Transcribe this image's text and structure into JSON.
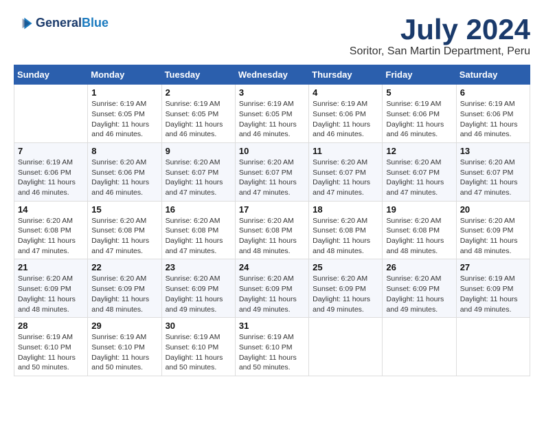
{
  "logo": {
    "line1": "General",
    "line2": "Blue"
  },
  "title": "July 2024",
  "subtitle": "Soritor, San Martin Department, Peru",
  "days_of_week": [
    "Sunday",
    "Monday",
    "Tuesday",
    "Wednesday",
    "Thursday",
    "Friday",
    "Saturday"
  ],
  "weeks": [
    [
      {
        "day": "",
        "info": ""
      },
      {
        "day": "1",
        "info": "Sunrise: 6:19 AM\nSunset: 6:05 PM\nDaylight: 11 hours\nand 46 minutes."
      },
      {
        "day": "2",
        "info": "Sunrise: 6:19 AM\nSunset: 6:05 PM\nDaylight: 11 hours\nand 46 minutes."
      },
      {
        "day": "3",
        "info": "Sunrise: 6:19 AM\nSunset: 6:05 PM\nDaylight: 11 hours\nand 46 minutes."
      },
      {
        "day": "4",
        "info": "Sunrise: 6:19 AM\nSunset: 6:06 PM\nDaylight: 11 hours\nand 46 minutes."
      },
      {
        "day": "5",
        "info": "Sunrise: 6:19 AM\nSunset: 6:06 PM\nDaylight: 11 hours\nand 46 minutes."
      },
      {
        "day": "6",
        "info": "Sunrise: 6:19 AM\nSunset: 6:06 PM\nDaylight: 11 hours\nand 46 minutes."
      }
    ],
    [
      {
        "day": "7",
        "info": "Sunrise: 6:19 AM\nSunset: 6:06 PM\nDaylight: 11 hours\nand 46 minutes."
      },
      {
        "day": "8",
        "info": "Sunrise: 6:20 AM\nSunset: 6:06 PM\nDaylight: 11 hours\nand 46 minutes."
      },
      {
        "day": "9",
        "info": "Sunrise: 6:20 AM\nSunset: 6:07 PM\nDaylight: 11 hours\nand 47 minutes."
      },
      {
        "day": "10",
        "info": "Sunrise: 6:20 AM\nSunset: 6:07 PM\nDaylight: 11 hours\nand 47 minutes."
      },
      {
        "day": "11",
        "info": "Sunrise: 6:20 AM\nSunset: 6:07 PM\nDaylight: 11 hours\nand 47 minutes."
      },
      {
        "day": "12",
        "info": "Sunrise: 6:20 AM\nSunset: 6:07 PM\nDaylight: 11 hours\nand 47 minutes."
      },
      {
        "day": "13",
        "info": "Sunrise: 6:20 AM\nSunset: 6:07 PM\nDaylight: 11 hours\nand 47 minutes."
      }
    ],
    [
      {
        "day": "14",
        "info": "Sunrise: 6:20 AM\nSunset: 6:08 PM\nDaylight: 11 hours\nand 47 minutes."
      },
      {
        "day": "15",
        "info": "Sunrise: 6:20 AM\nSunset: 6:08 PM\nDaylight: 11 hours\nand 47 minutes."
      },
      {
        "day": "16",
        "info": "Sunrise: 6:20 AM\nSunset: 6:08 PM\nDaylight: 11 hours\nand 47 minutes."
      },
      {
        "day": "17",
        "info": "Sunrise: 6:20 AM\nSunset: 6:08 PM\nDaylight: 11 hours\nand 48 minutes."
      },
      {
        "day": "18",
        "info": "Sunrise: 6:20 AM\nSunset: 6:08 PM\nDaylight: 11 hours\nand 48 minutes."
      },
      {
        "day": "19",
        "info": "Sunrise: 6:20 AM\nSunset: 6:08 PM\nDaylight: 11 hours\nand 48 minutes."
      },
      {
        "day": "20",
        "info": "Sunrise: 6:20 AM\nSunset: 6:09 PM\nDaylight: 11 hours\nand 48 minutes."
      }
    ],
    [
      {
        "day": "21",
        "info": "Sunrise: 6:20 AM\nSunset: 6:09 PM\nDaylight: 11 hours\nand 48 minutes."
      },
      {
        "day": "22",
        "info": "Sunrise: 6:20 AM\nSunset: 6:09 PM\nDaylight: 11 hours\nand 48 minutes."
      },
      {
        "day": "23",
        "info": "Sunrise: 6:20 AM\nSunset: 6:09 PM\nDaylight: 11 hours\nand 49 minutes."
      },
      {
        "day": "24",
        "info": "Sunrise: 6:20 AM\nSunset: 6:09 PM\nDaylight: 11 hours\nand 49 minutes."
      },
      {
        "day": "25",
        "info": "Sunrise: 6:20 AM\nSunset: 6:09 PM\nDaylight: 11 hours\nand 49 minutes."
      },
      {
        "day": "26",
        "info": "Sunrise: 6:20 AM\nSunset: 6:09 PM\nDaylight: 11 hours\nand 49 minutes."
      },
      {
        "day": "27",
        "info": "Sunrise: 6:19 AM\nSunset: 6:09 PM\nDaylight: 11 hours\nand 49 minutes."
      }
    ],
    [
      {
        "day": "28",
        "info": "Sunrise: 6:19 AM\nSunset: 6:10 PM\nDaylight: 11 hours\nand 50 minutes."
      },
      {
        "day": "29",
        "info": "Sunrise: 6:19 AM\nSunset: 6:10 PM\nDaylight: 11 hours\nand 50 minutes."
      },
      {
        "day": "30",
        "info": "Sunrise: 6:19 AM\nSunset: 6:10 PM\nDaylight: 11 hours\nand 50 minutes."
      },
      {
        "day": "31",
        "info": "Sunrise: 6:19 AM\nSunset: 6:10 PM\nDaylight: 11 hours\nand 50 minutes."
      },
      {
        "day": "",
        "info": ""
      },
      {
        "day": "",
        "info": ""
      },
      {
        "day": "",
        "info": ""
      }
    ]
  ]
}
